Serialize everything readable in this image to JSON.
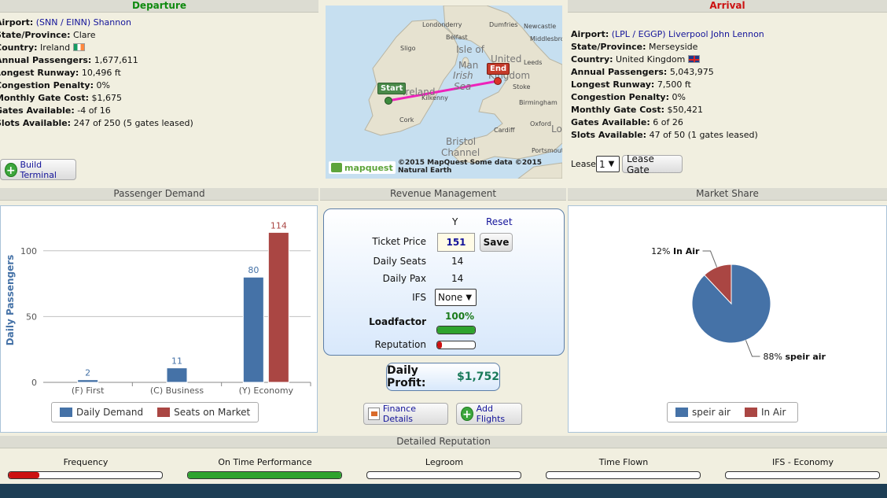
{
  "departure": {
    "header": "Departure",
    "airport_label": "Airport:",
    "airport_value": "(SNN / EINN) Shannon",
    "state_label": "State/Province:",
    "state_value": "Clare",
    "country_label": "Country:",
    "country_value": "Ireland",
    "passengers_label": "Annual Passengers:",
    "passengers_value": "1,677,611",
    "runway_label": "Longest Runway:",
    "runway_value": "10,496 ft",
    "congestion_label": "Congestion Penalty:",
    "congestion_value": "0%",
    "gatecost_label": "Monthly Gate Cost:",
    "gatecost_value": "$1,675",
    "gates_label": "Gates Available:",
    "gates_value": "-4 of 16",
    "slots_label": "Slots Available:",
    "slots_value": "247 of 250 (5 gates leased)",
    "build_button": "Build Terminal"
  },
  "map": {
    "labels": [
      "Londonderry",
      "Dumfries",
      "Newcastle",
      "Belfast",
      "Middlesbrough",
      "Isle of",
      "Man",
      "United",
      "Leeds",
      "Kingdom",
      "Sligo",
      "Irish",
      "Sea",
      "Stoke",
      "Ireland",
      "Kilkenny",
      "Birmingham",
      "Cork",
      "Cardiff",
      "Oxford",
      "Bristol",
      "Channel",
      "Portsmouth",
      "Lo"
    ],
    "start_label": "Start",
    "end_label": "End",
    "attribution": "©2015 MapQuest Some data ©2015 Natural Earth",
    "brand": "mapquest"
  },
  "arrival": {
    "header": "Arrival",
    "airport_label": "Airport:",
    "airport_value": "(LPL / EGGP) Liverpool John Lennon",
    "state_label": "State/Province:",
    "state_value": "Merseyside",
    "country_label": "Country:",
    "country_value": "United Kingdom",
    "passengers_label": "Annual Passengers:",
    "passengers_value": "5,043,975",
    "runway_label": "Longest Runway:",
    "runway_value": "7,500 ft",
    "congestion_label": "Congestion Penalty:",
    "congestion_value": "0%",
    "gatecost_label": "Monthly Gate Cost:",
    "gatecost_value": "$50,421",
    "gates_label": "Gates Available:",
    "gates_value": "6 of 26",
    "slots_label": "Slots Available:",
    "slots_value": "47 of 50 (1 gates leased)",
    "lease_label": "Lease",
    "lease_select": "1",
    "lease_button": "Lease Gate"
  },
  "sections": {
    "passenger_demand": "Passenger Demand",
    "revenue_management": "Revenue Management",
    "market_share": "Market Share",
    "detailed_reputation": "Detailed Reputation"
  },
  "revenue": {
    "col_header": "Y",
    "reset_link": "Reset",
    "ticket_price_label": "Ticket Price",
    "ticket_price_value": "151",
    "save_button": "Save",
    "daily_seats_label": "Daily Seats",
    "daily_seats_value": "14",
    "daily_pax_label": "Daily Pax",
    "daily_pax_value": "14",
    "ifs_label": "IFS",
    "ifs_value": "None",
    "loadfactor_label": "Loadfactor",
    "loadfactor_value": "100%",
    "loadfactor_fraction": 1.0,
    "reputation_label": "Reputation",
    "reputation_fraction": 0.12,
    "daily_profit_label": "Daily Profit:",
    "daily_profit_value": "$1,752",
    "finance_button": "Finance Details",
    "add_flights_button": "Add Flights"
  },
  "reputation": {
    "items": [
      {
        "label": "Frequency",
        "fraction": 0.2,
        "color": "#cc1111"
      },
      {
        "label": "On Time Performance",
        "fraction": 1.0,
        "color": "#2ea32e"
      },
      {
        "label": "Legroom",
        "fraction": 0.0,
        "color": "#2ea32e"
      },
      {
        "label": "Time Flown",
        "fraction": 0.0,
        "color": "#2ea32e"
      },
      {
        "label": "IFS - Economy",
        "fraction": 0.0,
        "color": "#2ea32e"
      }
    ]
  },
  "chart_data": [
    {
      "type": "bar",
      "title": "",
      "ylabel": "Daily Passengers",
      "xlabel": "",
      "categories": [
        "(F) First",
        "(C) Business",
        "(Y) Economy"
      ],
      "series": [
        {
          "name": "Daily Demand",
          "values": [
            2,
            11,
            80
          ],
          "color": "#4572a7"
        },
        {
          "name": "Seats on Market",
          "values": [
            null,
            null,
            114
          ],
          "color": "#aa4643"
        }
      ],
      "ylim": [
        0,
        125
      ],
      "yticks": [
        0,
        50,
        100
      ],
      "grid": true,
      "legend": "bottom"
    },
    {
      "type": "pie",
      "title": "",
      "slices": [
        {
          "name": "speir air",
          "value": 88,
          "label": "88%",
          "color": "#4572a7"
        },
        {
          "name": "In Air",
          "value": 12,
          "label": "12%",
          "color": "#aa4643"
        }
      ],
      "legend": "bottom"
    }
  ]
}
